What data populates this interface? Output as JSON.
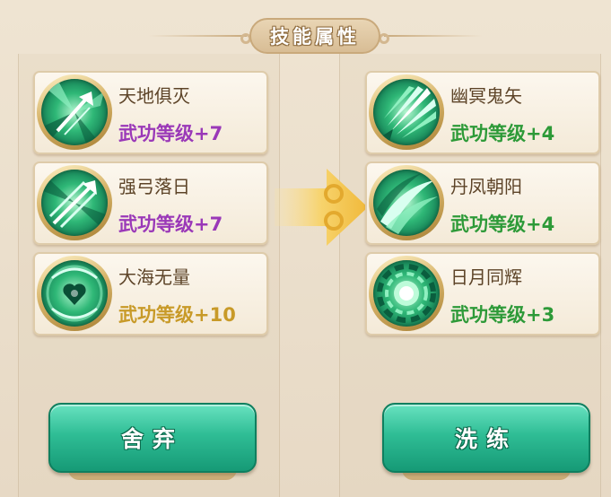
{
  "panel": {
    "title": "技能属性"
  },
  "left_skills": [
    {
      "name": "天地俱灭",
      "level": "武功等级+7",
      "icon": "arrow-burst-icon",
      "level_color": "#9a38b8"
    },
    {
      "name": "强弓落日",
      "level": "武功等级+7",
      "icon": "arrow-volley-icon",
      "level_color": "#9a38b8"
    },
    {
      "name": "大海无量",
      "level": "武功等级+10",
      "icon": "heart-sigil-icon",
      "level_color": "#c89a28"
    }
  ],
  "right_skills": [
    {
      "name": "幽冥鬼矢",
      "level": "武功等级+4",
      "icon": "feather-arrows-icon",
      "level_color": "#2d9a38"
    },
    {
      "name": "丹凤朝阳",
      "level": "武功等级+4",
      "icon": "wind-slash-icon",
      "level_color": "#2d9a38"
    },
    {
      "name": "日月同辉",
      "level": "武功等级+3",
      "icon": "radiant-orb-icon",
      "level_color": "#2d9a38"
    }
  ],
  "buttons": {
    "discard": "舍弃",
    "wash": "洗练"
  },
  "colors": {
    "button_green": "#2fbd95",
    "card_bg": "#fcf7ee",
    "arrow_gold": "#f5c94a"
  }
}
